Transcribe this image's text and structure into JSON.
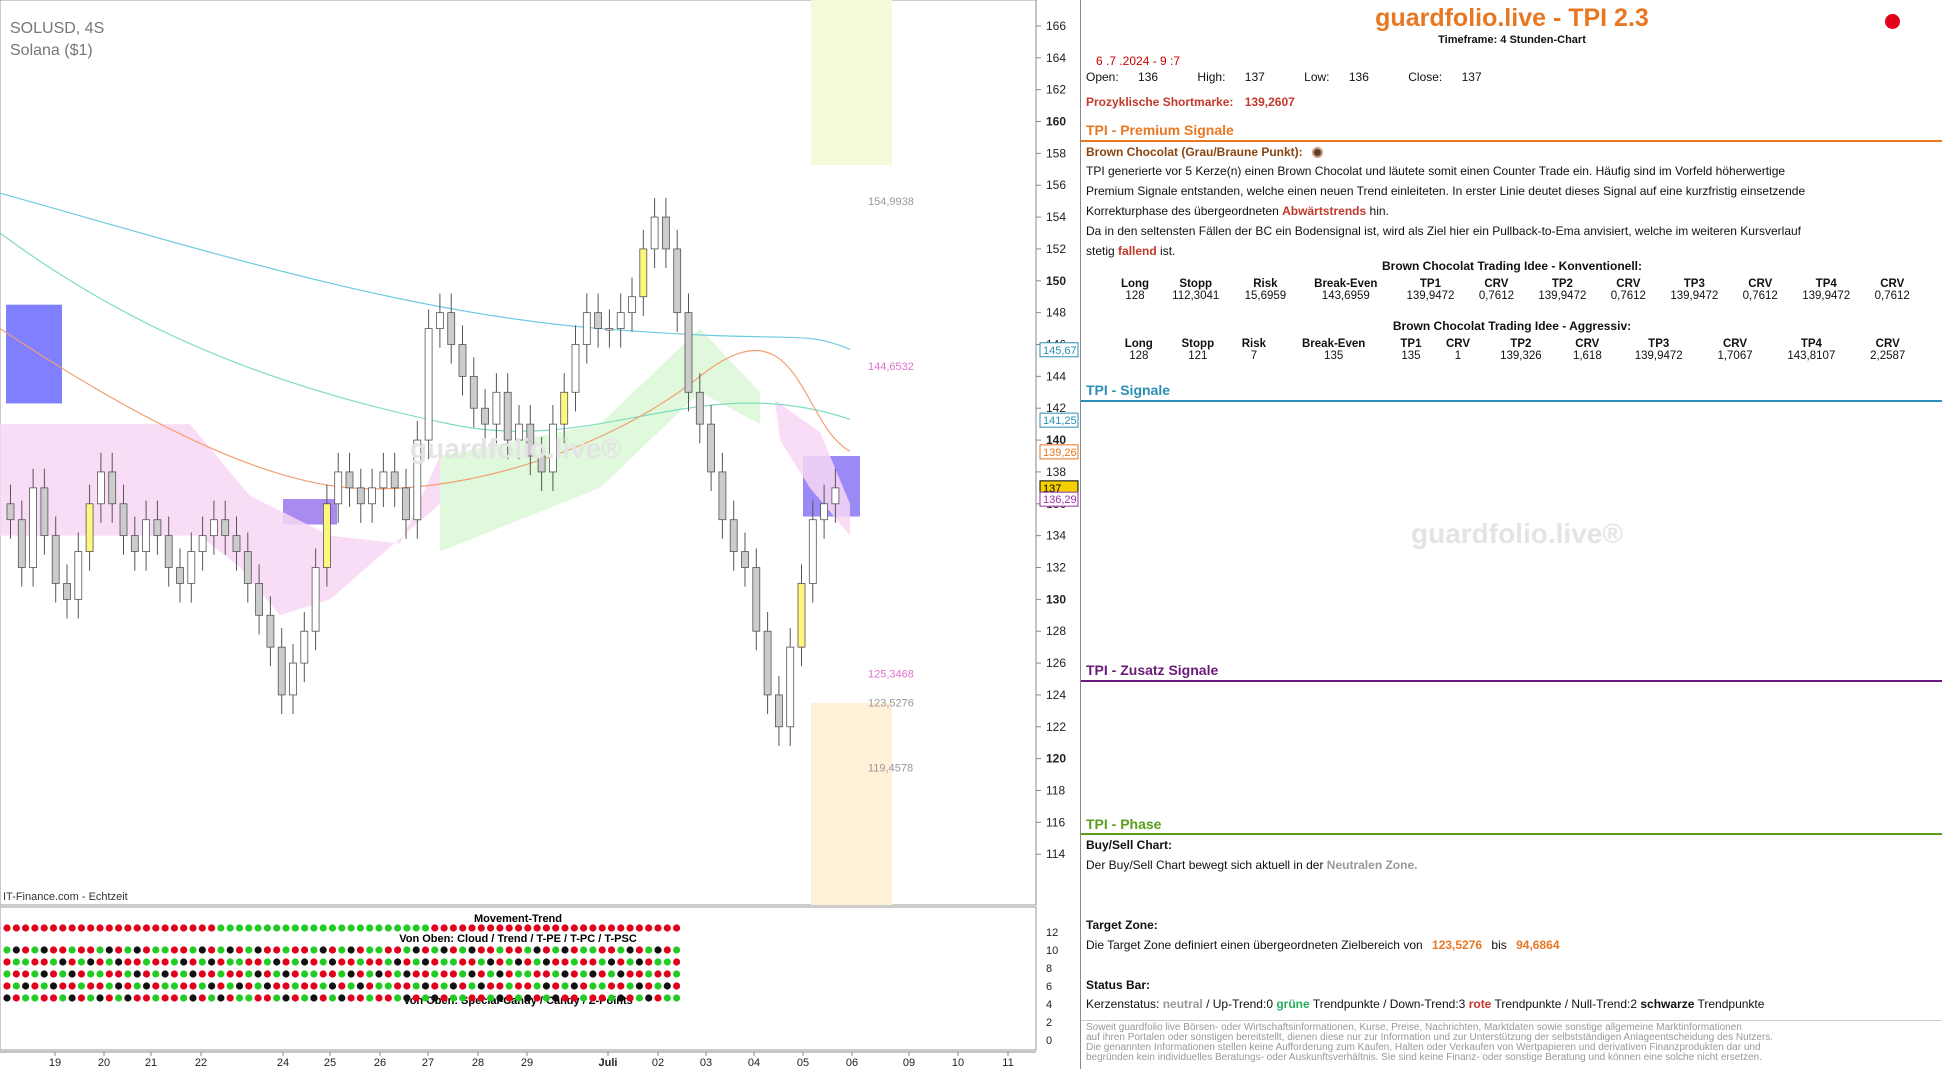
{
  "chart_header": {
    "symbol": "SOLUSD, 4S",
    "name": "Solana ($1)",
    "source": "IT-Finance.com - Echtzeit",
    "watermark": "guardfolio.live®"
  },
  "chart_data": {
    "type": "candlestick",
    "y_axis_ticks": [
      114,
      116,
      118,
      120,
      122,
      124,
      126,
      128,
      130,
      132,
      134,
      136,
      138,
      140,
      142,
      144,
      146,
      148,
      150,
      152,
      154,
      156,
      158,
      160,
      162,
      164,
      166
    ],
    "bold_ticks": [
      120,
      130,
      140,
      150,
      160
    ],
    "ylim": [
      111,
      167
    ],
    "x_tick_labels": [
      "19",
      "20",
      "21",
      "22",
      "24",
      "25",
      "26",
      "27",
      "28",
      "29",
      "Juli",
      "02",
      "03",
      "04",
      "05",
      "06",
      "09",
      "10",
      "11"
    ],
    "price_labels": [
      {
        "text": "145,67",
        "value": 145.67,
        "color": "#2b8fb5"
      },
      {
        "text": "141,25",
        "value": 141.25,
        "color": "#2b8fb5"
      },
      {
        "text": "139,26",
        "value": 139.26,
        "color": "#e87722"
      },
      {
        "text": "137",
        "value": 137,
        "color": "#000000",
        "bg": "#f5d000"
      },
      {
        "text": "136,29",
        "value": 136.29,
        "color": "#9b2fa8"
      }
    ],
    "level_labels": [
      {
        "text": "154,9938",
        "value": 154.9938,
        "color": "#999999"
      },
      {
        "text": "144,6532",
        "value": 144.6532,
        "color": "#e070d0"
      },
      {
        "text": "125,3468",
        "value": 125.3468,
        "color": "#e070d0"
      },
      {
        "text": "123,5276",
        "value": 123.5276,
        "color": "#999999"
      },
      {
        "text": "119,4578",
        "value": 119.4578,
        "color": "#999999"
      }
    ],
    "close_series": [
      135,
      132,
      137,
      134,
      131,
      130,
      133,
      136,
      138,
      136,
      134,
      133,
      135,
      134,
      132,
      131,
      133,
      134,
      135,
      134,
      133,
      131,
      129,
      127,
      124,
      126,
      128,
      132,
      136,
      138,
      137,
      136,
      137,
      138,
      137,
      135,
      140,
      147,
      148,
      146,
      144,
      142,
      141,
      143,
      140,
      141,
      139,
      138,
      141,
      143,
      146,
      148,
      147,
      147,
      148,
      149,
      152,
      154,
      152,
      148,
      143,
      141,
      138,
      135,
      133,
      132,
      128,
      124,
      122,
      127,
      131,
      135,
      136,
      137
    ],
    "indicator": {
      "title": "Movement-Trend",
      "row_label_top": "Von Oben: Cloud / Trend / T-PE / T-PC / T-PSC",
      "row_label_bottom": "Von Oben: Special-Candy / Candy / Z-Points",
      "y_ticks": [
        0,
        2,
        4,
        6,
        8,
        10,
        12
      ]
    }
  },
  "panel": {
    "title": "guardfolio.live - TPI 2.3",
    "timeframe": "Timeframe: 4 Stunden-Chart",
    "date": "6 .7 .2024  - 9 :7",
    "ohlc": {
      "open_label": "Open:",
      "open": "136",
      "high_label": "High:",
      "high": "137",
      "low_label": "Low:",
      "low": "136",
      "close_label": "Close:",
      "close": "137"
    },
    "shortmarke_label": "Prozyklische Shortmarke:",
    "shortmarke_value": "139,2607",
    "sections": {
      "premium": "TPI - Premium Signale",
      "signale": "TPI - Signale",
      "zusatz": "TPI - Zusatz Signale",
      "phase": "TPI - Phase"
    },
    "bc_title": "Brown Chocolat (Grau/Braune Punkt):",
    "bc_line1": "TPI generierte vor 5  Kerze(n) einen Brown Chocolat und läutete somit einen Counter Trade ein. Häufig sind im Vorfeld höherwertige",
    "bc_line2": "Premium Signale entstanden, welche einen neuen Trend einleiteten. In erster Linie deutet dieses Signal auf eine kurzfristig einsetzende",
    "bc_line3_pre": "Korrekturphase des übergeordneten",
    "bc_line3_em": "Abwärtstrends",
    "bc_line3_post": "hin.",
    "bc_line4": "Da in den seltensten Fällen der BC ein Bodensignal ist, wird als Ziel hier ein Pullback-to-Ema anvisiert, welche im weiteren Kursverlauf",
    "bc_line5_pre": "stetig",
    "bc_line5_em": "fallend",
    "bc_line5_post": "ist.",
    "konv_title": "Brown Chocolat Trading Idee - Konventionell:",
    "aggr_title": "Brown Chocolat Trading Idee - Aggressiv:",
    "table_headers": [
      "Long",
      "Stopp",
      "Risk",
      "Break-Even",
      "TP1",
      "CRV",
      "TP2",
      "CRV",
      "TP3",
      "CRV",
      "TP4",
      "CRV"
    ],
    "konv_values": [
      "128",
      "112,3041",
      "15,6959",
      "143,6959",
      "139,9472",
      "0,7612",
      "139,9472",
      "0,7612",
      "139,9472",
      "0,7612",
      "139,9472",
      "0,7612"
    ],
    "aggr_values": [
      "128",
      "121",
      "7",
      "135",
      "135",
      "1",
      "139,326",
      "1,618",
      "139,9472",
      "1,7067",
      "143,8107",
      "2,2587"
    ],
    "watermark": "guardfolio.live®",
    "buysell_title": "Buy/Sell Chart:",
    "buysell_pre": "Der Buy/Sell Chart bewegt sich aktuell in der",
    "buysell_em": "Neutralen Zone.",
    "target_title": "Target Zone:",
    "target_pre": "Die Target Zone definiert einen übergeordneten Zielbereich von",
    "target_v1": "123,5276",
    "target_mid": "bis",
    "target_v2": "94,6864",
    "status_title": "Status Bar:",
    "status_1": "Kerzenstatus:",
    "status_2": "neutral",
    "status_3": "/ Up-Trend:0",
    "status_4": "grüne",
    "status_5": "Trendpunkte  / Down-Trend:3",
    "status_6": "rote",
    "status_7": "Trendpunkte  / Null-Trend:2",
    "status_8": "schwarze",
    "status_9": "Trendpunkte",
    "footer1": "Soweit guardfolio live Börsen- oder Wirtschaftsinformationen, Kurse, Preise, Nachrichten, Marktdaten sowie sonstige allgemeine Marktinformationen",
    "footer2": "auf ihren Portalen oder sonstigen bereitstellt, dienen diese nur zur Information und zur Unterstützung der selbstständigen Anlageentscheidung des Nutzers.",
    "footer3": "Die genannten Informationen stellen keine Aufforderung zum Kaufen, Halten oder Verkaufen von Wertpapieren und derivativen Finanzprodukten dar und",
    "footer4": "begründen kein individuelles Beratungs- oder Auskunftsverhältnis. Sie sind keine Finanz- oder sonstige Beratung und können eine solche nicht ersetzen."
  }
}
